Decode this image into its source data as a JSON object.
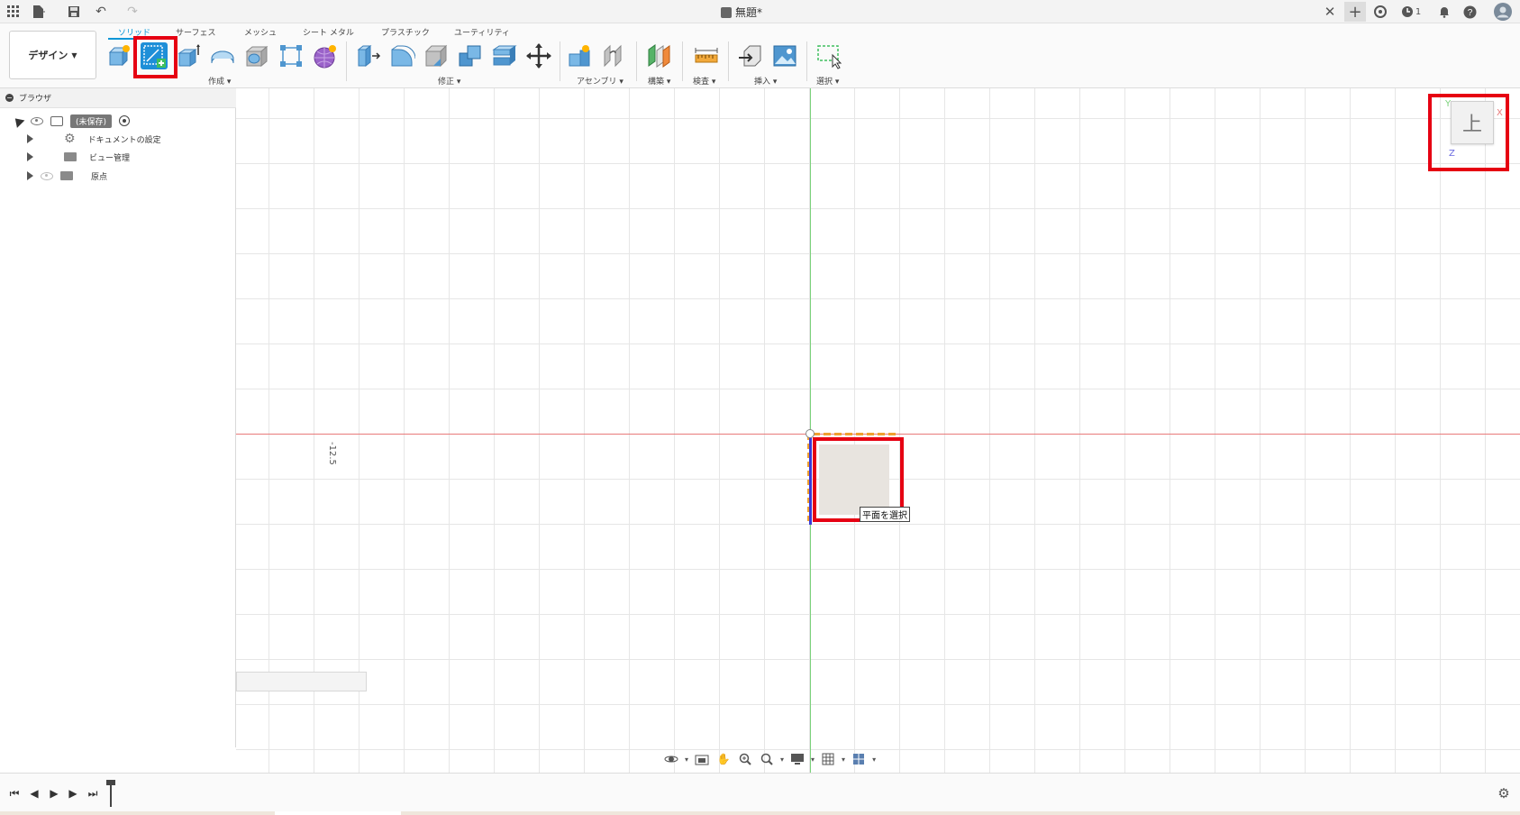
{
  "window": {
    "title": "無題*"
  },
  "titlebar": {
    "notification_count": "1"
  },
  "toolbar": {
    "workspace_label": "デザイン",
    "tabs": [
      {
        "label": "ソリッド",
        "active": true
      },
      {
        "label": "サーフェス"
      },
      {
        "label": "メッシュ"
      },
      {
        "label": "シート メタル"
      },
      {
        "label": "プラスチック"
      },
      {
        "label": "ユーティリティ"
      }
    ],
    "groups": {
      "create": "作成",
      "modify": "修正",
      "assemble": "アセンブリ",
      "construct": "構築",
      "inspect": "検査",
      "insert": "挿入",
      "select": "選択"
    }
  },
  "browser": {
    "title": "ブラウザ",
    "root_label": "(未保存)",
    "items": [
      {
        "label": "ドキュメントの設定"
      },
      {
        "label": "ビュー管理"
      },
      {
        "label": "原点"
      }
    ]
  },
  "canvas": {
    "ruler_label": "-12.5",
    "select_plane_tooltip": "平面を選択",
    "viewcube_face": "上",
    "axis_labels": {
      "x": "X",
      "y": "Y",
      "z": "Z"
    }
  },
  "colors": {
    "accent": "#0696d7",
    "highlight": "#e60012",
    "x_axis": "#e87a7a",
    "y_axis": "#7bd17b",
    "z_axis": "#3a3ad6"
  }
}
